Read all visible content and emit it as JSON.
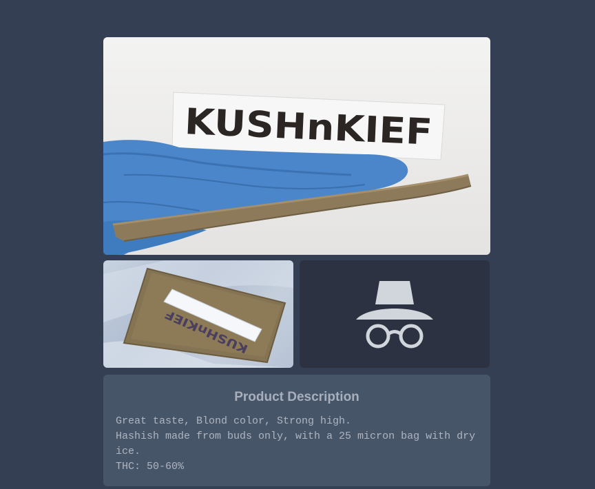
{
  "gallery": {
    "main_image": {
      "label_text": "KUSHnKIEF"
    },
    "thumbnail_left": {
      "label_text": "KUSHnKIEF"
    },
    "thumbnail_right": {
      "icon": "incognito-icon"
    }
  },
  "description": {
    "title": "Product Description",
    "lines": [
      "Great taste, Blond color, Strong high.",
      "Hashish made from buds only, with a 25 micron bag with dry ice.",
      "THC: 50-60%"
    ]
  },
  "colors": {
    "background": "#343f53",
    "card": "#475569",
    "incognito_bg": "#2c3242",
    "glove_blue": "#4a86c9"
  }
}
